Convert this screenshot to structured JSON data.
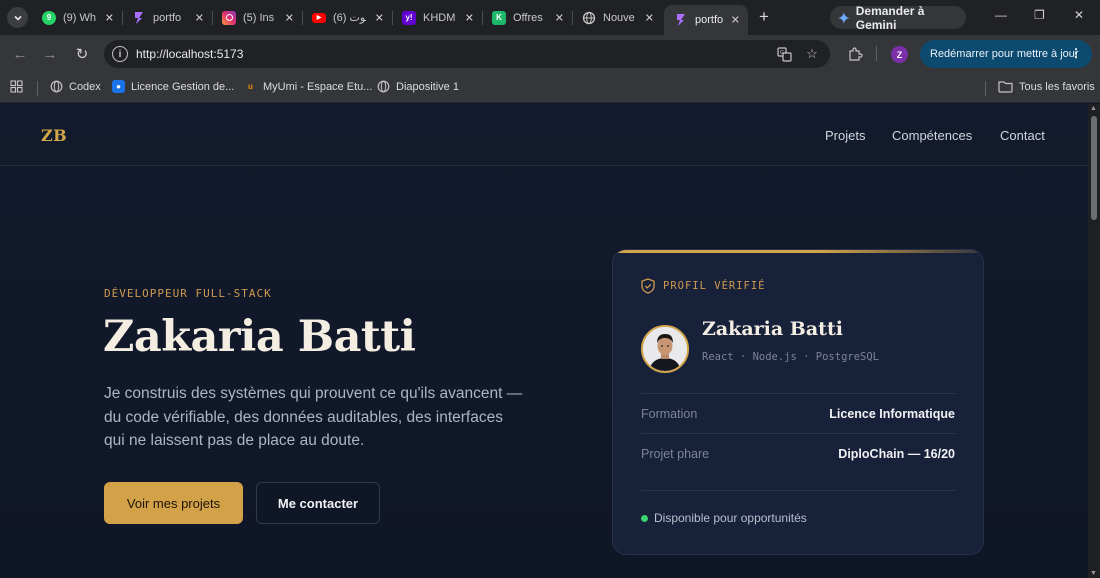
{
  "browser": {
    "tabs": [
      {
        "title": "(9) Wh",
        "fav_color": "#25d366",
        "fav_glyph": "9",
        "active": false
      },
      {
        "title": "portfo",
        "fav_color": "#8b5cf6",
        "fav_glyph": "",
        "active": false
      },
      {
        "title": "(5) Ins",
        "fav_color": "#e1306c",
        "fav_glyph": "",
        "active": false
      },
      {
        "title": "(6) يوت",
        "fav_color": "#ff0000",
        "fav_glyph": "▶",
        "active": false
      },
      {
        "title": "KHDM",
        "fav_color": "#6001d2",
        "fav_glyph": "y!",
        "active": false
      },
      {
        "title": "Offres",
        "fav_color": "#1fb76a",
        "fav_glyph": "K",
        "active": false
      },
      {
        "title": "Nouve",
        "fav_color": "#5f6368",
        "fav_glyph": "",
        "active": false
      },
      {
        "title": "portfo",
        "fav_color": "#8b5cf6",
        "fav_glyph": "",
        "active": true
      }
    ],
    "gemini_label": "Demander à Gemini",
    "url": "http://localhost:5173",
    "profile_initial": "Z",
    "update_label": "Redémarrer pour mettre à jour",
    "bookmarks": [
      {
        "label": "Codex",
        "fav_color": "#5f6368"
      },
      {
        "label": "Licence Gestion de...",
        "fav_color": "#1a73e8"
      },
      {
        "label": "MyUmi - Espace Etu...",
        "fav_color": "#f28b00"
      },
      {
        "label": "Diapositive 1",
        "fav_color": "#5f6368"
      }
    ],
    "all_bookmarks_label": "Tous les favoris"
  },
  "site": {
    "logo": "ZB",
    "nav": [
      "Projets",
      "Compétences",
      "Contact"
    ],
    "hero": {
      "eyebrow": "DÉVELOPPEUR FULL-STACK",
      "name": "Zakaria Batti",
      "description": "Je construis des systèmes qui prouvent ce qu'ils avancent — du code vérifiable, des données auditables, des interfaces qui ne laissent pas de place au doute.",
      "primary_cta": "Voir mes projets",
      "secondary_cta": "Me contacter"
    },
    "card": {
      "label": "PROFIL VÉRIFIÉ",
      "name": "Zakaria Batti",
      "stack": "React · Node.js · PostgreSQL",
      "rows": [
        {
          "label": "Formation",
          "value": "Licence Informatique"
        },
        {
          "label": "Projet phare",
          "value": "DiploChain — 16/20"
        }
      ],
      "status": "Disponible pour opportunités"
    },
    "accent_color": "#d4a64a",
    "status_color": "#3bd16f"
  }
}
